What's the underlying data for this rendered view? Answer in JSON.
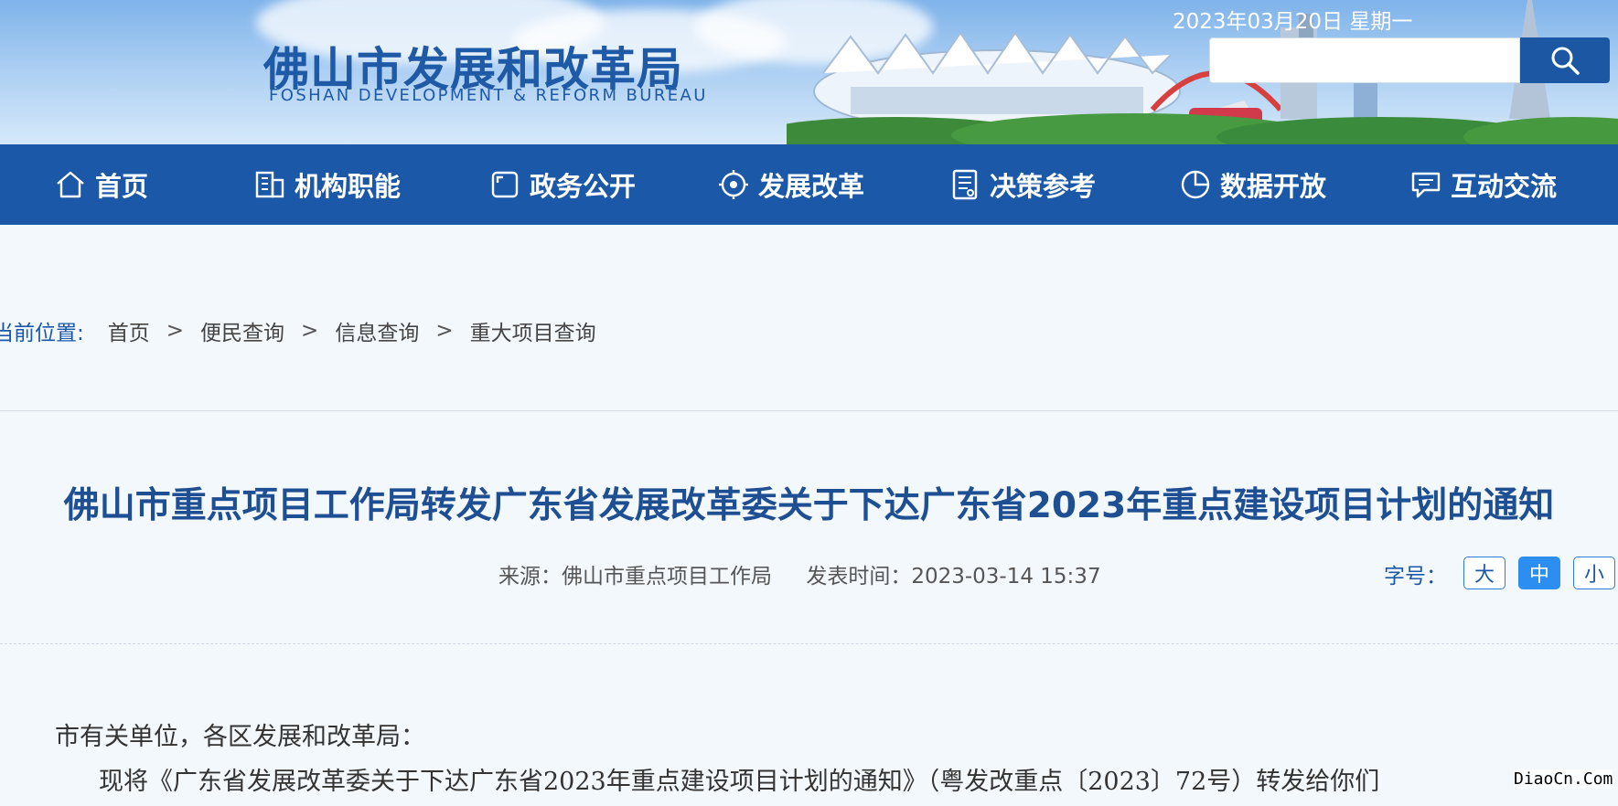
{
  "header": {
    "site_name_cn": "佛山市发展和改革局",
    "site_name_en": "FOSHAN DEVELOPMENT & REFORM BUREAU",
    "date": "2023年03月20日 星期一",
    "search": {
      "value": "",
      "placeholder": ""
    }
  },
  "nav": {
    "items": [
      {
        "label": "首页",
        "icon": "home-icon"
      },
      {
        "label": "机构职能",
        "icon": "building-icon"
      },
      {
        "label": "政务公开",
        "icon": "frame-icon"
      },
      {
        "label": "发展改革",
        "icon": "target-icon"
      },
      {
        "label": "决策参考",
        "icon": "document-icon"
      },
      {
        "label": "数据开放",
        "icon": "pie-chart-icon"
      },
      {
        "label": "互动交流",
        "icon": "chat-icon"
      }
    ]
  },
  "breadcrumb": {
    "label": "当前位置:",
    "items": [
      "首页",
      "便民查询",
      "信息查询",
      "重大项目查询"
    ],
    "separator": ">"
  },
  "article": {
    "title": "佛山市重点项目工作局转发广东省发展改革委关于下达广东省2023年重点建设项目计划的通知",
    "source": "来源：佛山市重点项目工作局",
    "published": "发表时间：2023-03-14 15:37",
    "font_size_label": "字号：",
    "font_sizes": [
      "大",
      "中",
      "小"
    ],
    "font_size_selected": "中",
    "paragraphs": [
      "市有关单位，各区发展和改革局：",
      "现将《广东省发展改革委关于下达广东省2023年重点建设项目计划的通知》（粤发改重点〔2023〕72号）转发给你们"
    ]
  },
  "watermark": "DiaoCn.Com",
  "colors": {
    "nav_bg": "#1c58a8",
    "title": "#1f4f93",
    "accent_button": "#2b8ef0",
    "page_bg": "#f3f8fd"
  }
}
